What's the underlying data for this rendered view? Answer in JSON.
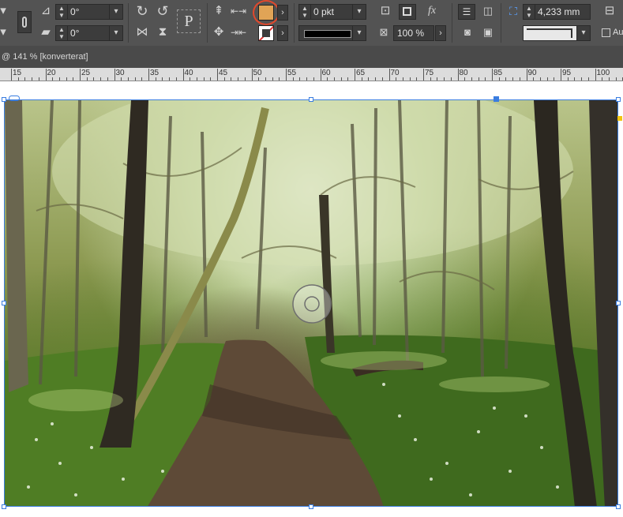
{
  "control_panel": {
    "row1": {
      "shear_angle": "0°",
      "stroke_weight": "0 pkt",
      "width_value": "4,233 mm"
    },
    "row2": {
      "rotation_angle": "0°",
      "opacity": "100 %"
    },
    "fill_color": "#e0a456",
    "highlight_ring_color": "#e0482c",
    "checkbox_label": "Au"
  },
  "document_tab": {
    "label": "@ 141 % [konverterat]"
  },
  "ruler": {
    "labels": [
      "15",
      "20",
      "25",
      "30",
      "35",
      "40",
      "45",
      "50",
      "55",
      "60",
      "65",
      "70",
      "75",
      "80",
      "85",
      "90",
      "95",
      "100"
    ]
  },
  "canvas": {
    "frame_selection_color": "#3a7de0"
  }
}
